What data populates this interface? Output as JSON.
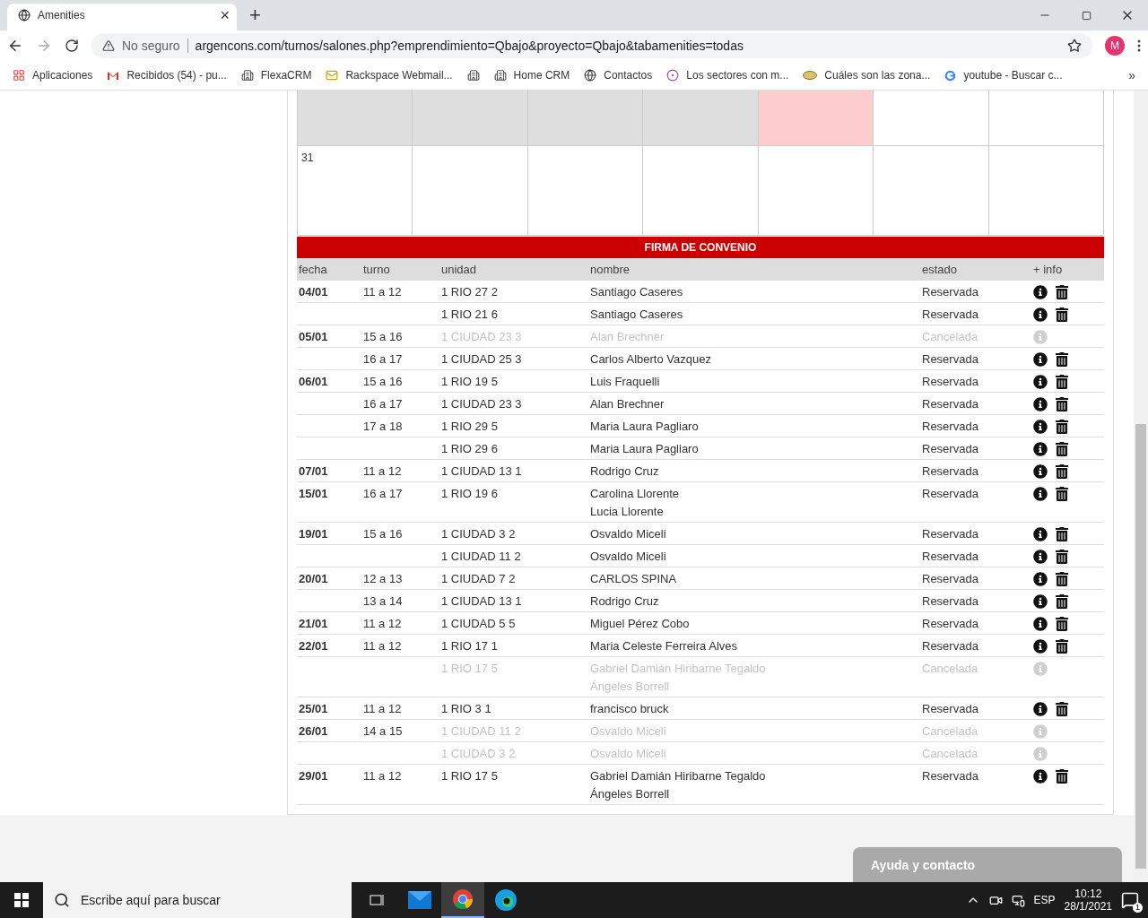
{
  "browser": {
    "tab": {
      "title": "Amenities",
      "close": "×"
    },
    "new_tab": "+",
    "security": "No seguro",
    "url": "argencons.com/turnos/salones.php?emprendimiento=Qbajo&proyecto=Qbajo&tabamenities=todas",
    "profile": "M",
    "bookmarks": [
      {
        "kind": "apps",
        "label": "Aplicaciones"
      },
      {
        "kind": "gmail",
        "label": "Recibidos (54) - pu..."
      },
      {
        "kind": "building",
        "label": "FlexaCRM"
      },
      {
        "kind": "mail",
        "label": "Rackspace Webmail..."
      },
      {
        "kind": "building"
      },
      {
        "kind": "building",
        "label": "Home CRM"
      },
      {
        "kind": "globe",
        "label": "Contactos"
      },
      {
        "kind": "dots",
        "label": "Los sectores con m..."
      },
      {
        "kind": "dish",
        "label": "Cuáles son las zona..."
      },
      {
        "kind": "google",
        "label": "youtube - Buscar c..."
      }
    ],
    "more": "»"
  },
  "calendar": {
    "weeks": [
      [
        {
          "kind": "other"
        },
        {
          "kind": "other"
        },
        {
          "kind": "other"
        },
        {
          "kind": "other"
        },
        {
          "kind": "today"
        },
        {
          "kind": "day"
        },
        {
          "kind": "day"
        }
      ],
      [
        {
          "kind": "day",
          "day": "31"
        },
        {
          "kind": "day"
        },
        {
          "kind": "day"
        },
        {
          "kind": "day"
        },
        {
          "kind": "day"
        },
        {
          "kind": "day"
        },
        {
          "kind": "day"
        }
      ]
    ]
  },
  "section_title": "FIRMA DE CONVENIO",
  "columns": [
    "fecha",
    "turno",
    "unidad",
    "nombre",
    "estado",
    "+ info"
  ],
  "rows": [
    {
      "fecha": "04/01",
      "turno": "11 a 12",
      "unidad": "1 RIO 27 2",
      "nombre": [
        "Santiago Caseres"
      ],
      "estado": "Reservada",
      "cancelled": false
    },
    {
      "unidad": "1 RIO 21 6",
      "nombre": [
        "Santiago Caseres"
      ],
      "estado": "Reservada",
      "cancelled": false
    },
    {
      "fecha": "05/01",
      "turno": "15 a 16",
      "unidad": "1 CIUDAD 23 3",
      "nombre": [
        "Alan Brechner"
      ],
      "estado": "Cancelada",
      "cancelled": true
    },
    {
      "turno": "16 a 17",
      "unidad": "1 CIUDAD 25 3",
      "nombre": [
        "Carlos Alberto Vazquez"
      ],
      "estado": "Reservada",
      "cancelled": false
    },
    {
      "fecha": "06/01",
      "turno": "15 a 16",
      "unidad": "1 RIO 19 5",
      "nombre": [
        "Luis Fraquelli"
      ],
      "estado": "Reservada",
      "cancelled": false
    },
    {
      "turno": "16 a 17",
      "unidad": "1 CIUDAD 23 3",
      "nombre": [
        "Alan Brechner"
      ],
      "estado": "Reservada",
      "cancelled": false
    },
    {
      "turno": "17 a 18",
      "unidad": "1 RIO 29 5",
      "nombre": [
        "Maria Laura Pagliaro"
      ],
      "estado": "Reservada",
      "cancelled": false
    },
    {
      "unidad": "1 RIO 29 6",
      "nombre": [
        "Maria Laura Pagliaro"
      ],
      "estado": "Reservada",
      "cancelled": false
    },
    {
      "fecha": "07/01",
      "turno": "11 a 12",
      "unidad": "1 CIUDAD 13 1",
      "nombre": [
        "Rodrigo Cruz"
      ],
      "estado": "Reservada",
      "cancelled": false
    },
    {
      "fecha": "15/01",
      "turno": "16 a 17",
      "unidad": "1 RIO 19 6",
      "nombre": [
        "Carolina Llorente",
        "Lucia Llorente"
      ],
      "estado": "Reservada",
      "cancelled": false
    },
    {
      "fecha": "19/01",
      "turno": "15 a 16",
      "unidad": "1 CIUDAD 3 2",
      "nombre": [
        "Osvaldo Miceli"
      ],
      "estado": "Reservada",
      "cancelled": false
    },
    {
      "unidad": "1 CIUDAD 11 2",
      "nombre": [
        "Osvaldo Miceli"
      ],
      "estado": "Reservada",
      "cancelled": false
    },
    {
      "fecha": "20/01",
      "turno": "12 a 13",
      "unidad": "1 CIUDAD 7 2",
      "nombre": [
        "CARLOS SPINA"
      ],
      "estado": "Reservada",
      "cancelled": false
    },
    {
      "turno": "13 a 14",
      "unidad": "1 CIUDAD 13 1",
      "nombre": [
        "Rodrigo Cruz"
      ],
      "estado": "Reservada",
      "cancelled": false
    },
    {
      "fecha": "21/01",
      "turno": "11 a 12",
      "unidad": "1 CIUDAD 5 5",
      "nombre": [
        "Miguel Pérez Cobo"
      ],
      "estado": "Reservada",
      "cancelled": false
    },
    {
      "fecha": "22/01",
      "turno": "11 a 12",
      "unidad": "1 RIO 17 1",
      "nombre": [
        "Maria Celeste Ferreira Alves"
      ],
      "estado": "Reservada",
      "cancelled": false
    },
    {
      "unidad": "1 RIO 17 5",
      "nombre": [
        "Gabriel Damián Hiribarne Tegaldo",
        "Ángeles Borrell"
      ],
      "estado": "Cancelada",
      "cancelled": true
    },
    {
      "fecha": "25/01",
      "turno": "11 a 12",
      "unidad": "1 RIO 3 1",
      "nombre": [
        "francisco bruck"
      ],
      "estado": "Reservada",
      "cancelled": false
    },
    {
      "fecha": "26/01",
      "turno": "14 a 15",
      "unidad": "1 CIUDAD 11 2",
      "nombre": [
        "Osvaldo Miceli"
      ],
      "estado": "Cancelada",
      "cancelled": true
    },
    {
      "unidad": "1 CIUDAD 3 2",
      "nombre": [
        "Osvaldo Miceli"
      ],
      "estado": "Cancelada",
      "cancelled": true
    },
    {
      "fecha": "29/01",
      "turno": "11 a 12",
      "unidad": "1 RIO 17 5",
      "nombre": [
        "Gabriel Damián Hiribarne Tegaldo",
        "Ángeles Borrell"
      ],
      "estado": "Reservada",
      "cancelled": false
    }
  ],
  "help_button": "Ayuda y contacto",
  "taskbar": {
    "search_placeholder": "Escribe aquí para buscar",
    "language": "ESP",
    "time": "10:12",
    "date": "28/1/2021",
    "notifications": "1"
  }
}
